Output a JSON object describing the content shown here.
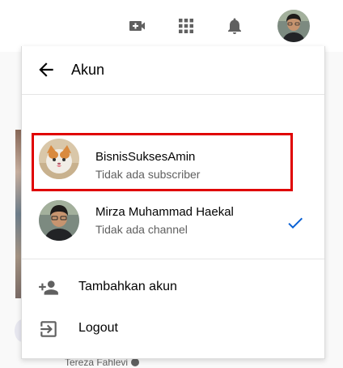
{
  "topbar": {
    "icons": [
      "video-camera-plus-icon",
      "apps-grid-icon",
      "bell-icon"
    ],
    "avatar": "user-avatar"
  },
  "background": {
    "channel_text": "Tereza Fahlevi"
  },
  "popup": {
    "title": "Akun",
    "back_icon": "arrow-left-icon",
    "accounts": [
      {
        "name": "BisnisSuksesAmin",
        "subtitle": "Tidak ada subscriber",
        "highlighted": true,
        "selected": false
      },
      {
        "name": "Mirza Muhammad Haekal",
        "subtitle": "Tidak ada channel",
        "highlighted": false,
        "selected": true
      }
    ],
    "menu": [
      {
        "label": "Tambahkan akun",
        "icon": "person-add-icon"
      },
      {
        "label": "Logout",
        "icon": "logout-icon"
      }
    ]
  },
  "colors": {
    "highlight": "#e00000",
    "check": "#065fd4",
    "icon": "#606060"
  }
}
